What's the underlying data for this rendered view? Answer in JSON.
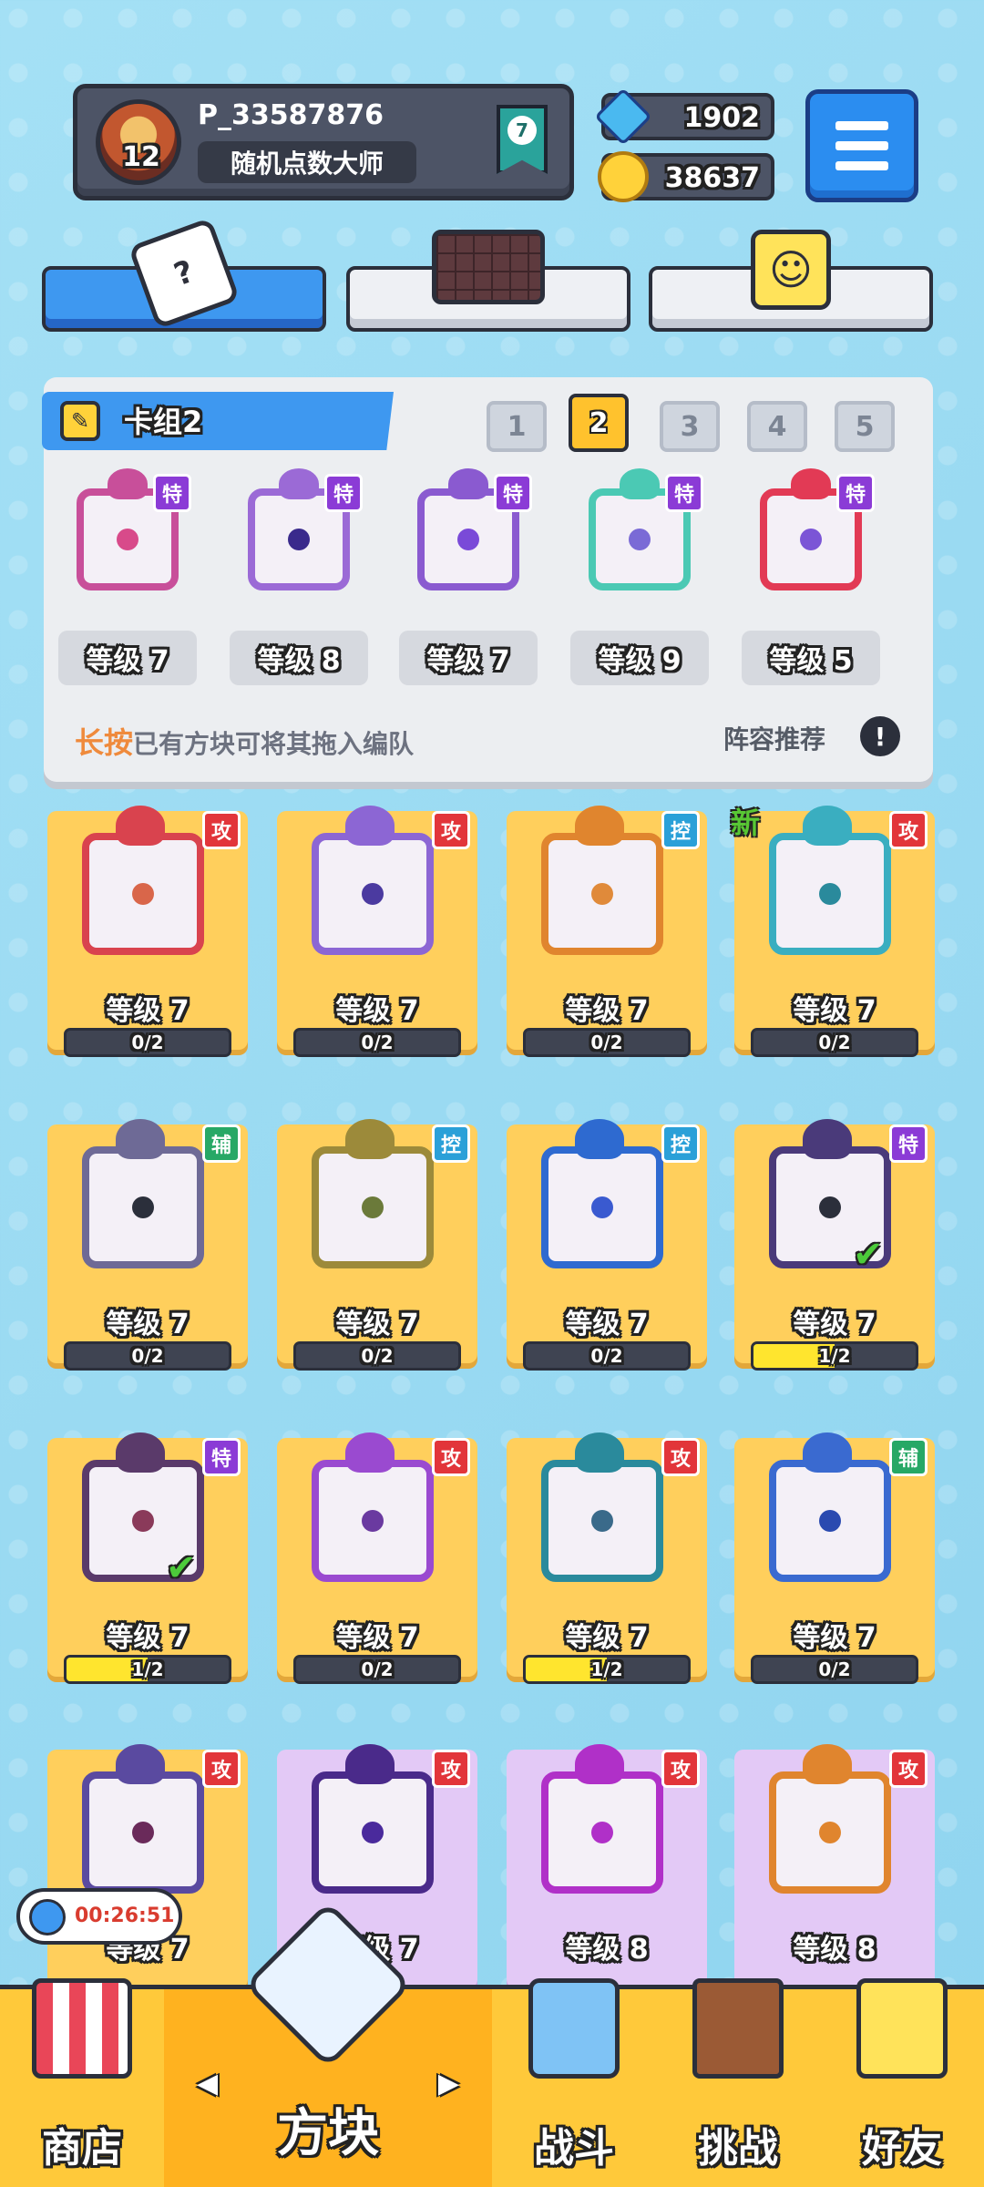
{
  "profile": {
    "player_name": "P_33587876",
    "title": "随机点数大师",
    "avatar_level": "12",
    "rank": "7"
  },
  "currency": {
    "gems": "1902",
    "coins": "38637"
  },
  "deck": {
    "title": "卡组2",
    "numbers": [
      "1",
      "2",
      "3",
      "4",
      "5"
    ],
    "active_number": "2",
    "dice": [
      {
        "tag": "特",
        "level": "等级 7",
        "color": "#c84f9a",
        "pip": "#d84a8a"
      },
      {
        "tag": "特",
        "level": "等级 8",
        "color": "#9b6ad6",
        "pip": "#3a2a8c"
      },
      {
        "tag": "特",
        "level": "等级 7",
        "color": "#8a5ad0",
        "pip": "#7a4ad8"
      },
      {
        "tag": "特",
        "level": "等级 9",
        "color": "#4bc9b4",
        "pip": "#7a6ad6"
      },
      {
        "tag": "特",
        "level": "等级 5",
        "color": "#e23a55",
        "pip": "#7b55d6"
      }
    ],
    "hint_highlight": "长按",
    "hint": "已有方块可将其拖入编队",
    "recommend": "阵容推荐",
    "info_symbol": "!"
  },
  "collection": [
    {
      "tag": "攻",
      "level": "等级 7",
      "progress": "0/2",
      "fill": 0,
      "color": "#d9434e",
      "pip": "#d9664a",
      "new": false,
      "check": false,
      "style": "gold"
    },
    {
      "tag": "攻",
      "level": "等级 7",
      "progress": "0/2",
      "fill": 0,
      "color": "#8c66d4",
      "pip": "#4b3aa0",
      "new": false,
      "check": false,
      "style": "gold"
    },
    {
      "tag": "控",
      "level": "等级 7",
      "progress": "0/2",
      "fill": 0,
      "color": "#e0852e",
      "pip": "#e08a3a",
      "new": false,
      "check": false,
      "style": "gold"
    },
    {
      "tag": "攻",
      "level": "等级 7",
      "progress": "0/2",
      "fill": 0,
      "color": "#3aaec0",
      "pip": "#2a8a9c",
      "new": true,
      "check": false,
      "style": "gold"
    },
    {
      "tag": "辅",
      "level": "等级 7",
      "progress": "0/2",
      "fill": 0,
      "color": "#6e6a96",
      "pip": "#2b2f3b",
      "new": false,
      "check": false,
      "style": "gold"
    },
    {
      "tag": "控",
      "level": "等级 7",
      "progress": "0/2",
      "fill": 0,
      "color": "#9c8a3a",
      "pip": "#6b7a3a",
      "new": false,
      "check": false,
      "style": "gold"
    },
    {
      "tag": "控",
      "level": "等级 7",
      "progress": "0/2",
      "fill": 0,
      "color": "#2e6ad0",
      "pip": "#3a5ad0",
      "new": false,
      "check": false,
      "style": "gold"
    },
    {
      "tag": "特",
      "level": "等级 7",
      "progress": "1/2",
      "fill": 0.5,
      "color": "#4a3a7a",
      "pip": "#2b2f3b",
      "new": false,
      "check": true,
      "style": "gold"
    },
    {
      "tag": "特",
      "level": "等级 7",
      "progress": "1/2",
      "fill": 0.5,
      "color": "#5a3a6a",
      "pip": "#8a3a5a",
      "new": false,
      "check": true,
      "style": "gold"
    },
    {
      "tag": "攻",
      "level": "等级 7",
      "progress": "0/2",
      "fill": 0,
      "color": "#9a4ad0",
      "pip": "#6a3aa0",
      "new": false,
      "check": false,
      "style": "gold"
    },
    {
      "tag": "攻",
      "level": "等级 7",
      "progress": "1/2",
      "fill": 0.5,
      "color": "#2a8a9c",
      "pip": "#3a6a8a",
      "new": false,
      "check": false,
      "style": "gold"
    },
    {
      "tag": "辅",
      "level": "等级 7",
      "progress": "0/2",
      "fill": 0,
      "color": "#3a6ad0",
      "pip": "#2a4ab0",
      "new": false,
      "check": false,
      "style": "gold"
    },
    {
      "tag": "攻",
      "level": "等级 7",
      "progress": "",
      "fill": 0,
      "color": "#5a4aa0",
      "pip": "#6a2a5a",
      "new": false,
      "check": false,
      "style": "gold"
    },
    {
      "tag": "攻",
      "level": "等级 7",
      "progress": "",
      "fill": 0,
      "color": "#4a2a8a",
      "pip": "#4a2a9c",
      "new": false,
      "check": false,
      "style": "purple"
    },
    {
      "tag": "攻",
      "level": "等级 8",
      "progress": "",
      "fill": 0,
      "color": "#b030c8",
      "pip": "#b030c8",
      "new": false,
      "check": false,
      "style": "purple"
    },
    {
      "tag": "攻",
      "level": "等级 8",
      "progress": "",
      "fill": 0,
      "color": "#e0852e",
      "pip": "#e0852e",
      "new": false,
      "check": false,
      "style": "purple"
    }
  ],
  "new_label": "新",
  "timer": "00:26:51",
  "nav": {
    "shop": "商店",
    "blocks": "方块",
    "battle": "战斗",
    "challenge": "挑战",
    "friends": "好友"
  },
  "tab_icons": {
    "dice": "?"
  }
}
